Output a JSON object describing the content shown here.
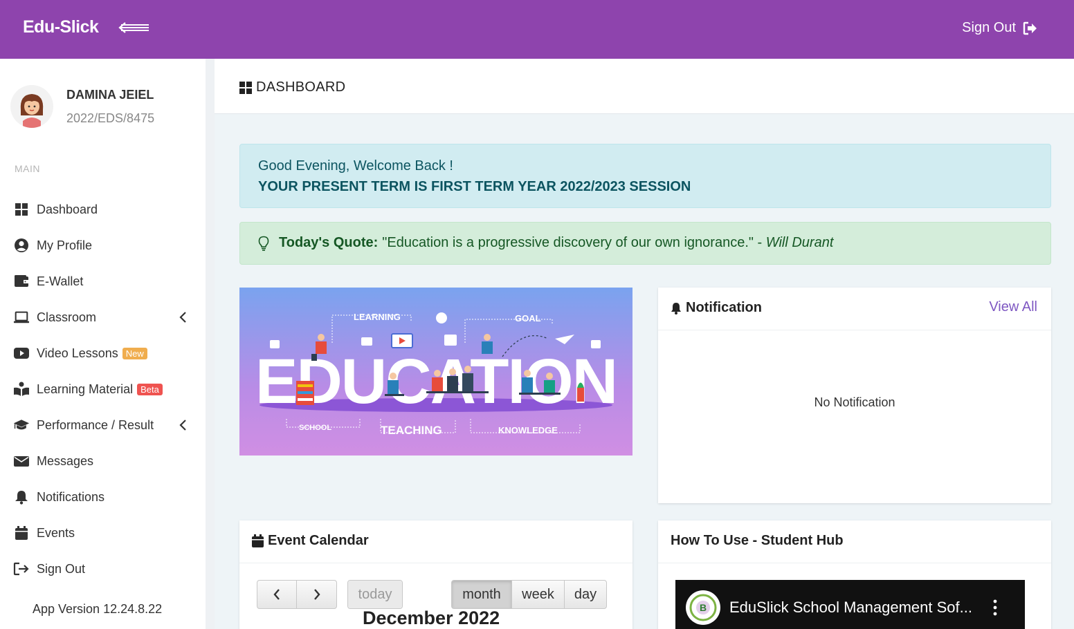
{
  "topbar": {
    "brand": "Edu-Slick",
    "sign_out": "Sign Out",
    "accent": "#8e44ad"
  },
  "user": {
    "name": "DAMINA JEIEL",
    "id": "2022/EDS/8475"
  },
  "sidebar": {
    "section": "MAIN",
    "items": [
      {
        "label": "Dashboard",
        "icon": "dashboard-icon"
      },
      {
        "label": "My Profile",
        "icon": "user-circle-icon"
      },
      {
        "label": "E-Wallet",
        "icon": "wallet-icon"
      },
      {
        "label": "Classroom",
        "icon": "laptop-icon",
        "expandable": true
      },
      {
        "label": "Video Lessons",
        "icon": "youtube-icon",
        "badge": "New"
      },
      {
        "label": "Learning Material",
        "icon": "reader-icon",
        "badge": "Beta"
      },
      {
        "label": "Performance / Result",
        "icon": "graduation-cap-icon",
        "expandable": true
      },
      {
        "label": "Messages",
        "icon": "envelope-icon"
      },
      {
        "label": "Notifications",
        "icon": "bell-icon"
      },
      {
        "label": "Events",
        "icon": "calendar-icon"
      },
      {
        "label": "Sign Out",
        "icon": "sign-out-icon"
      }
    ],
    "app_version": "App Version 12.24.8.22"
  },
  "page": {
    "title": "DASHBOARD"
  },
  "welcome": {
    "greeting": "Good Evening, Welcome Back !",
    "term": "YOUR PRESENT TERM IS FIRST TERM YEAR 2022/2023 SESSION"
  },
  "quote": {
    "label": "Today's Quote:",
    "text": "\"Education is a progressive discovery of our own ignorance.\" - ",
    "author": "Will Durant"
  },
  "banner": {
    "word": "EDUCATION",
    "labels": [
      "LEARNING",
      "GOAL",
      "SCHOOL",
      "TEACHING",
      "KNOWLEDGE"
    ]
  },
  "notification": {
    "title": "Notification",
    "view_all": "View All",
    "empty": "No Notification"
  },
  "calendar": {
    "title": "Event Calendar",
    "prev": "‹",
    "next": "›",
    "today": "today",
    "views": [
      "month",
      "week",
      "day"
    ],
    "active_view": "month",
    "month_title": "December 2022"
  },
  "howto": {
    "title": "How To Use - Student Hub",
    "video_title": "EduSlick School Management Sof..."
  }
}
